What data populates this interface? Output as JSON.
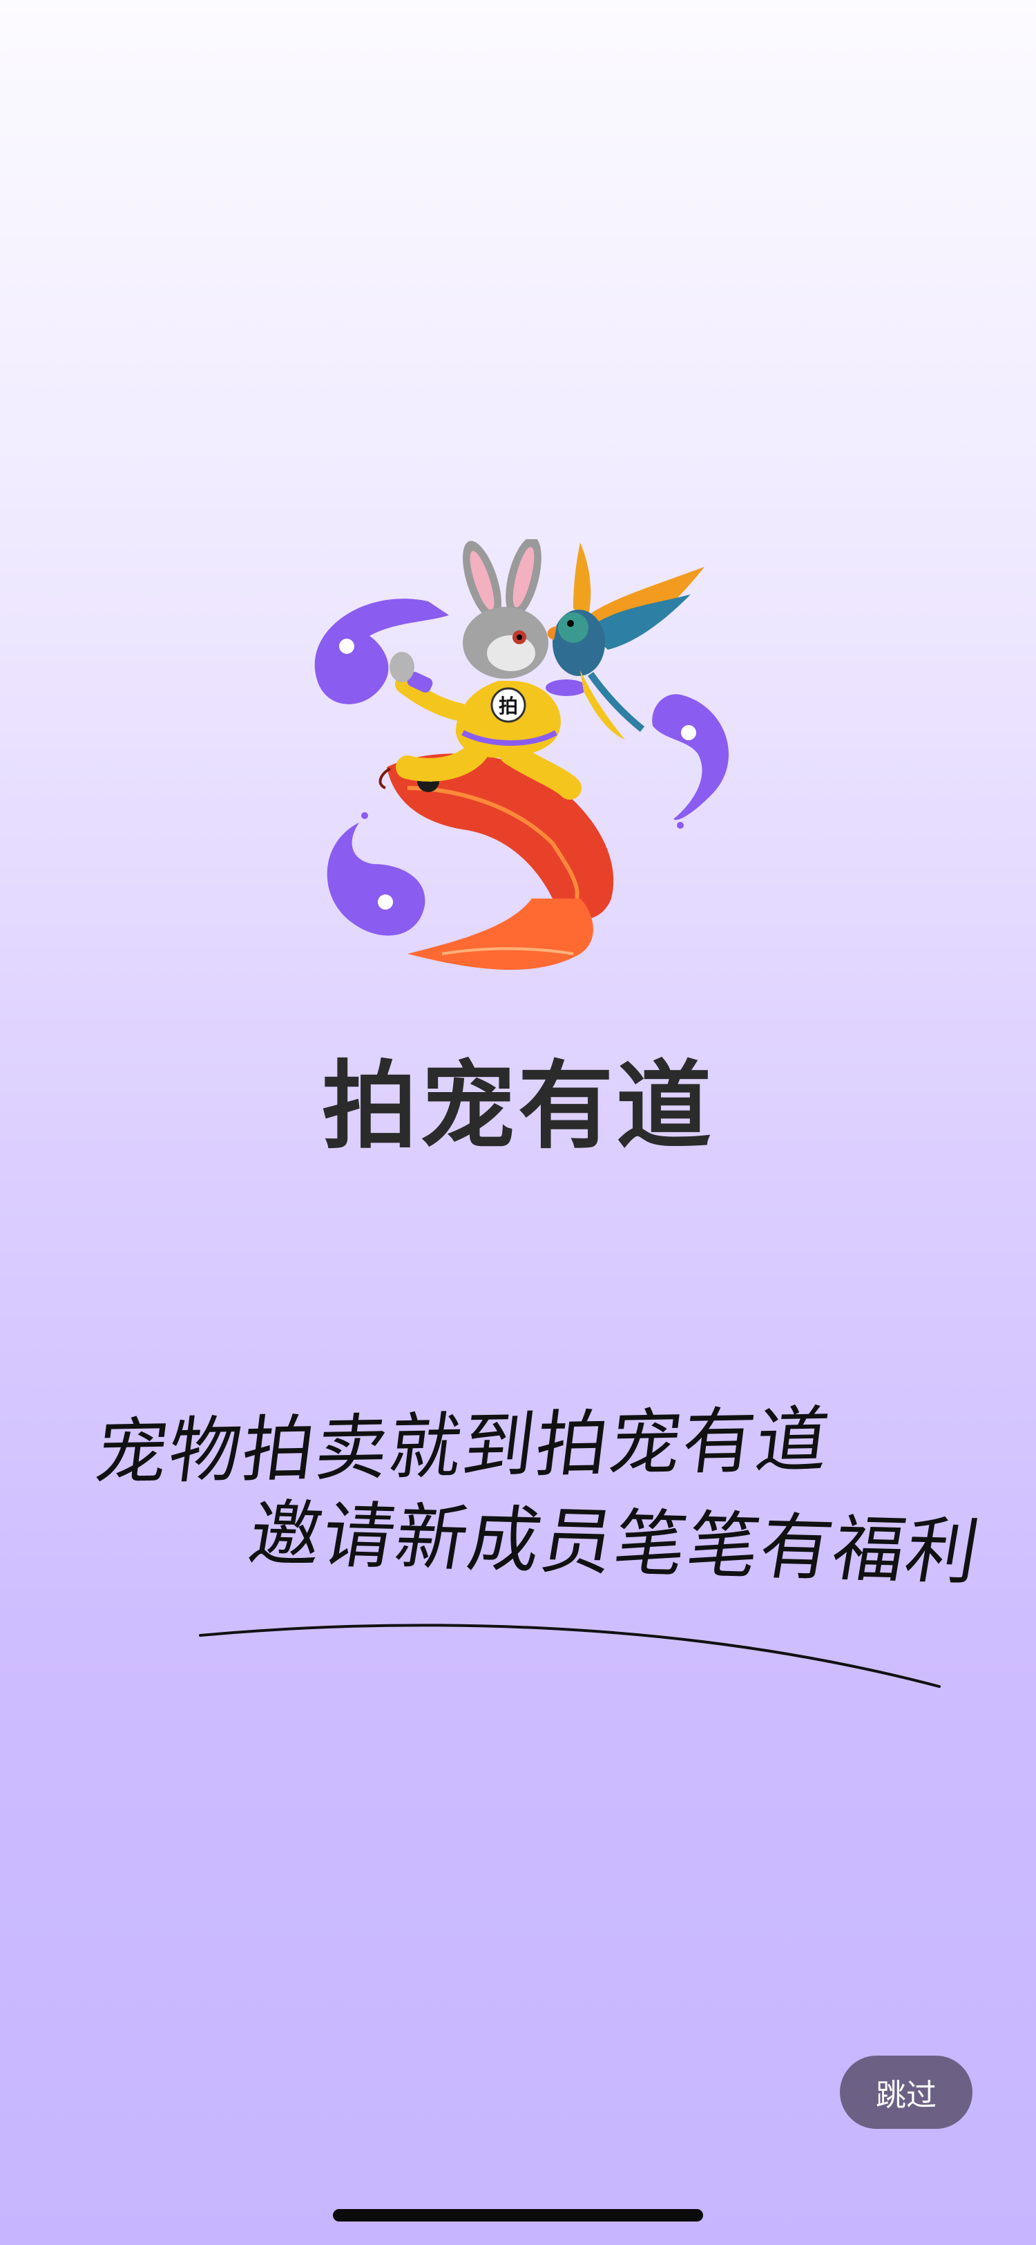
{
  "splash": {
    "app_name": "拍宠有道",
    "logo_badge_text": "拍",
    "slogan_line1": "宠物拍卖就到拍宠有道",
    "slogan_line2": "邀请新成员笔笔有福利",
    "skip_label": "跳过"
  },
  "colors": {
    "brand_purple": "#8a5cf0",
    "skip_bg": "#6c6185",
    "title_text": "#2b2b2b"
  },
  "icons": {
    "logo": "rabbit-parrot-koi-mascot-icon"
  }
}
